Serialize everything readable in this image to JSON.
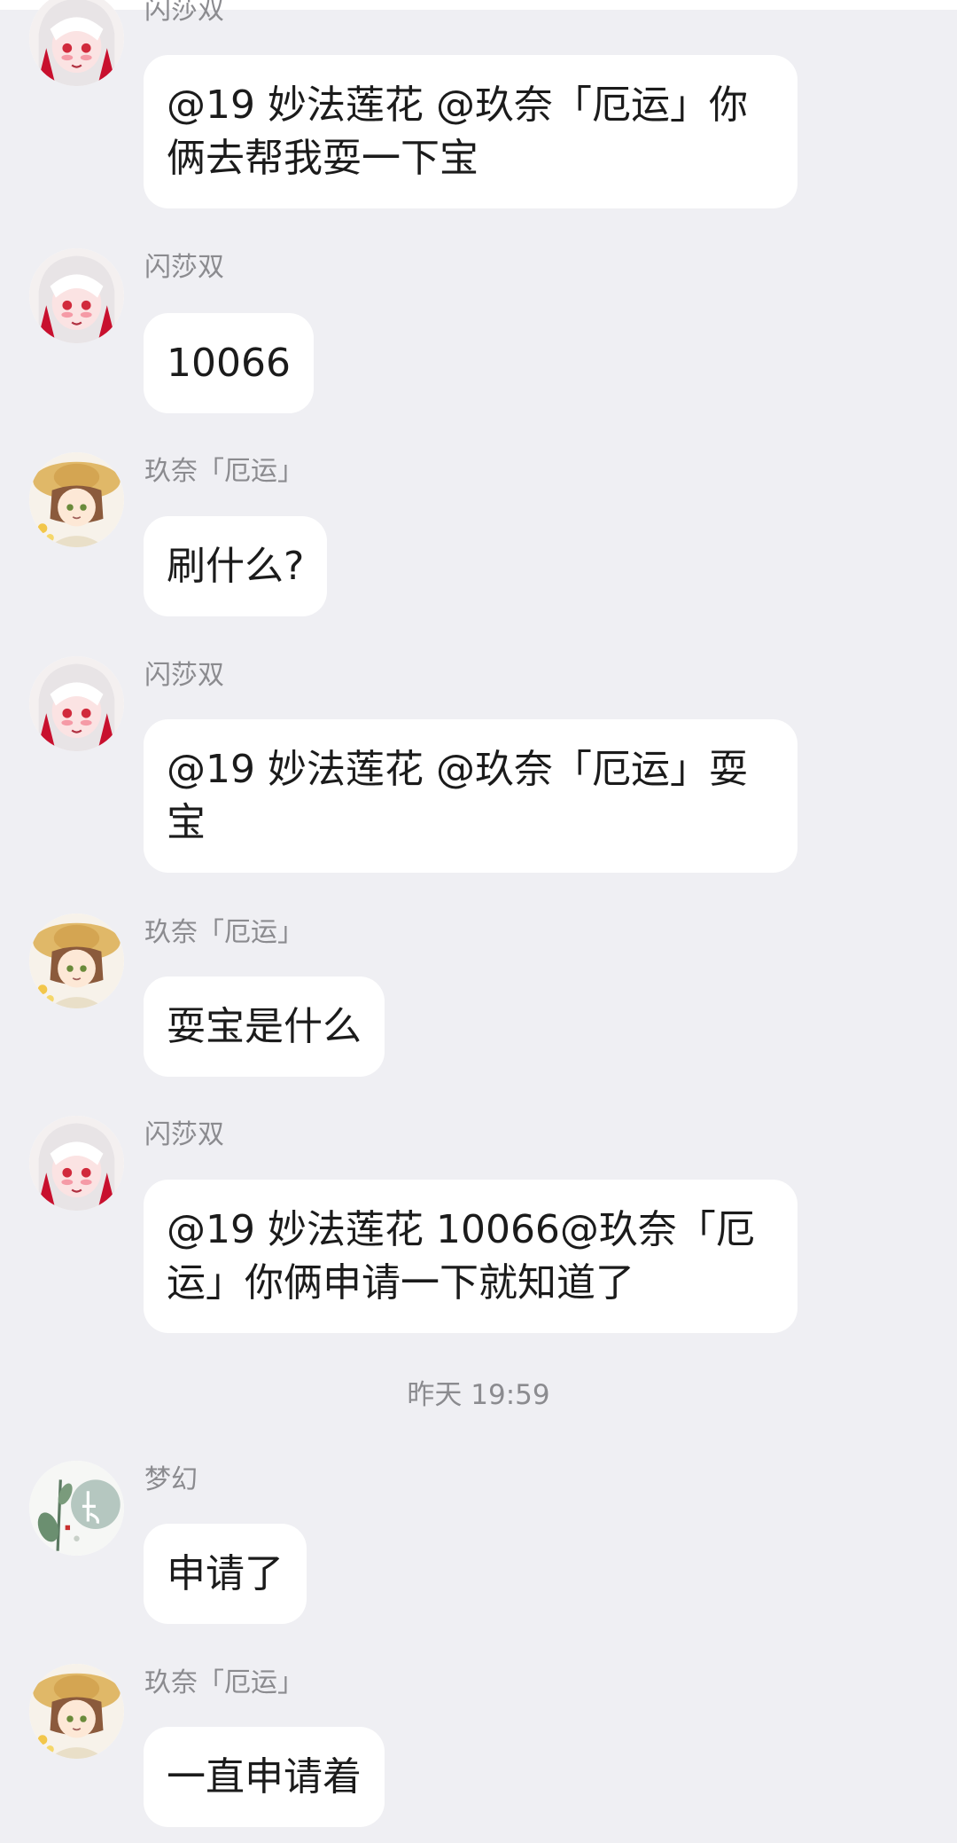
{
  "messages": [
    {
      "sender": "闪莎双",
      "text": "@19  妙法莲花 @玖奈「厄运」你俩去帮我耍一下宝",
      "avatar": "red-white-anime-avatar"
    },
    {
      "sender": "闪莎双",
      "text": "10066",
      "avatar": "red-white-anime-avatar"
    },
    {
      "sender": "玖奈「厄运」",
      "text": "刷什么?",
      "avatar": "straw-hat-anime-avatar"
    },
    {
      "sender": "闪莎双",
      "text": "@19  妙法莲花 @玖奈「厄运」耍宝",
      "avatar": "red-white-anime-avatar"
    },
    {
      "sender": "玖奈「厄运」",
      "text": "耍宝是什么",
      "avatar": "straw-hat-anime-avatar"
    },
    {
      "sender": "闪莎双",
      "text": "@19  妙法莲花 10066@玖奈「厄运」你俩申请一下就知道了",
      "avatar": "red-white-anime-avatar"
    },
    {
      "sender": "梦幻",
      "text": "申请了",
      "avatar": "ink-lotus-avatar"
    },
    {
      "sender": "玖奈「厄运」",
      "text": "一直申请着",
      "avatar": "straw-hat-anime-avatar"
    }
  ],
  "timestamp": "昨天 19:59",
  "colors": {
    "background": "#efeff3",
    "bubble": "#ffffff",
    "sender_text": "#8b8b8f",
    "message_text": "#1b1b1b"
  }
}
